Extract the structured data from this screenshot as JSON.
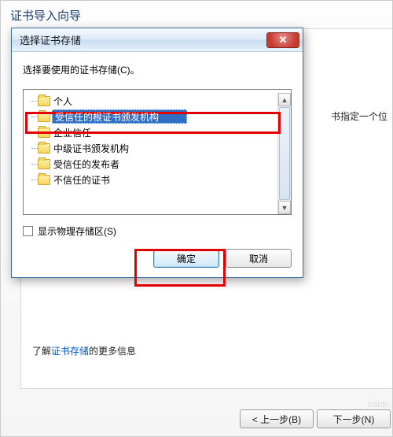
{
  "wizard": {
    "title": "证书导入向导",
    "right_clip_text": "书指定一个位",
    "learn_prefix": "了解",
    "learn_link": "证书存储",
    "learn_suffix": "的更多信息",
    "prev_btn": "< 上一步(B)",
    "next_btn": "下一步(N)"
  },
  "modal": {
    "title": "选择证书存储",
    "instruction": "选择要使用的证书存储(C)。",
    "tree": {
      "items": [
        {
          "label": "个人",
          "selected": false
        },
        {
          "label": "受信任的根证书颁发机构",
          "selected": true
        },
        {
          "label": "企业信任",
          "selected": false
        },
        {
          "label": "中级证书颁发机构",
          "selected": false
        },
        {
          "label": "受信任的发布者",
          "selected": false
        },
        {
          "label": "不信任的证书",
          "selected": false
        }
      ]
    },
    "show_physical_label": "显示物理存储区(S)",
    "ok_btn": "确定",
    "cancel_btn": "取消"
  }
}
